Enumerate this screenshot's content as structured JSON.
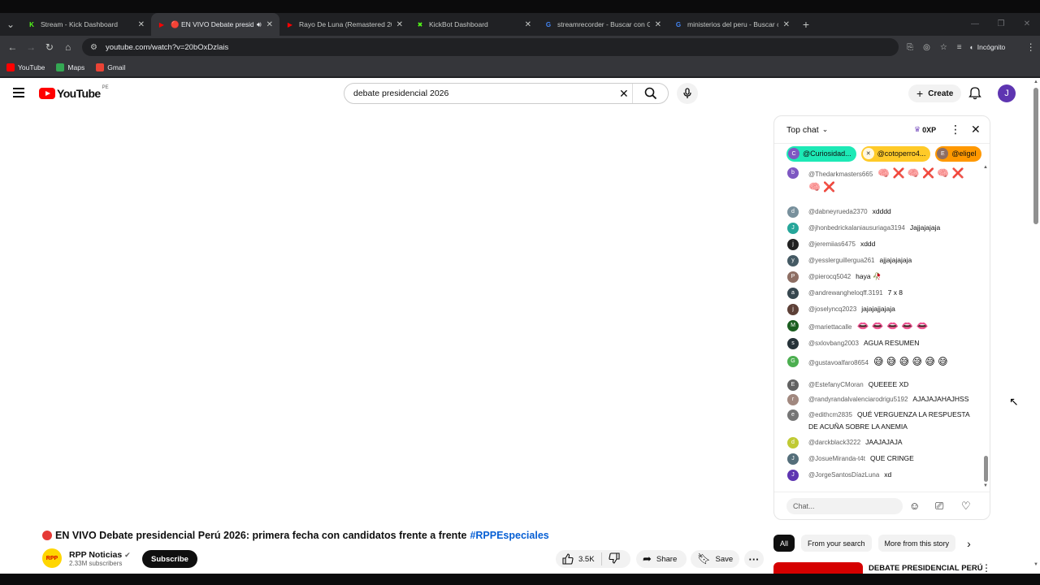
{
  "browser": {
    "tabs": [
      {
        "title": "Stream - Kick Dashboard",
        "color": "#53fc18",
        "glyph": "K"
      },
      {
        "title": "🔴 EN VIVO Debate preside",
        "color": "#ff0000",
        "glyph": "▶",
        "active": true
      },
      {
        "title": "Rayo De Luna (Remastered 201",
        "color": "#ff0000",
        "glyph": "▶"
      },
      {
        "title": "KickBot Dashboard",
        "color": "#53fc18",
        "glyph": "✖"
      },
      {
        "title": "streamrecorder - Buscar con Go",
        "color": "#4285f4",
        "glyph": "G"
      },
      {
        "title": "ministerios del peru - Buscar co",
        "color": "#4285f4",
        "glyph": "G"
      }
    ],
    "url": "youtube.com/watch?v=20bOxDzlais",
    "incognito_label": "Incógnito",
    "bookmarks": [
      {
        "label": "YouTube",
        "color": "#ff0000"
      },
      {
        "label": "Maps",
        "color": "#34a853"
      },
      {
        "label": "Gmail",
        "color": "#ea4335"
      }
    ]
  },
  "youtube": {
    "logo_word": "YouTube",
    "country_code": "PE",
    "search_value": "debate presidencial 2026",
    "create_label": "Create",
    "avatar_letter": "J"
  },
  "video": {
    "title": "EN VIVO Debate presidencial Perú 2026: primera fecha con candidatos frente a frente",
    "hashtag": "#RPPEspeciales",
    "channel_name": "RPP Noticias",
    "channel_logo_text": "RPP",
    "subscribers": "2.33M subscribers",
    "subscribe_label": "Subscribe",
    "likes": "3.5K",
    "share_label": "Share",
    "save_label": "Save"
  },
  "chat": {
    "mode_label": "Top chat",
    "xp_label": "0XP",
    "pinned": [
      {
        "name": "@Curiosidad...",
        "bg": "#1de9b6",
        "av_color": "#7e57c2",
        "av": "C"
      },
      {
        "name": "@cotoperro4...",
        "bg": "#ffca28",
        "av_color": "#fff8e1",
        "av": "✕"
      },
      {
        "name": "@eligel",
        "bg": "#ff9800",
        "av_color": "#8d6e63",
        "av": "E"
      }
    ],
    "messages": [
      {
        "author": "@Thedarkmasters665",
        "text": "🧠 ❌ 🧠 ❌ 🧠 ❌ 🧠 ❌",
        "av_color": "#7e57c2",
        "av": "b"
      },
      {
        "author": "@dabneyrueda2370",
        "text": "xdddd",
        "av_color": "#78909c",
        "av": "d"
      },
      {
        "author": "@jhonbedrickalaniausuriaga3194",
        "text": "Jajjajajaja",
        "av_color": "#26a69a",
        "av": "J"
      },
      {
        "author": "@jeremiias6475",
        "text": "xddd",
        "av_color": "#212121",
        "av": "j"
      },
      {
        "author": "@yesslerguillergua261",
        "text": "ajjajajajaja",
        "av_color": "#455a64",
        "av": "y"
      },
      {
        "author": "@pierocq5042",
        "text": "haya 🥀",
        "av_color": "#8d6e63",
        "av": "P"
      },
      {
        "author": "@andrewangheloqff.3191",
        "text": "7 x 8",
        "av_color": "#37474f",
        "av": "a"
      },
      {
        "author": "@joselyncq2023",
        "text": "jajajajjajaja",
        "av_color": "#5d4037",
        "av": "j"
      },
      {
        "author": "@mariettacalle",
        "text": "👄 👄 👄 👄 👄",
        "av_color": "#1b5e20",
        "av": "M"
      },
      {
        "author": "@sxlovbang2003",
        "text": "AGUA RESUMEN",
        "av_color": "#263238",
        "av": "s"
      },
      {
        "author": "@gustavoalfaro8654",
        "text": "😅 😅 😅 😅 😅 😅",
        "av_color": "#4caf50",
        "av": "G"
      },
      {
        "author": "@EstefanyCMoran",
        "text": "QUEEEE XD",
        "av_color": "#616161",
        "av": "E"
      },
      {
        "author": "@randyrandalvalenciarodrigu5192",
        "text": "AJAJAJAHAJHSS",
        "av_color": "#a1887f",
        "av": "r"
      },
      {
        "author": "@edithcm2835",
        "text": "QUÉ VERGUENZA LA RESPUESTA DE ACUÑA SOBRE LA ANEMIA",
        "av_color": "#757575",
        "av": "e"
      },
      {
        "author": "@darckblack3222",
        "text": "JAAJAJAJA",
        "av_color": "#c0ca33",
        "av": "d"
      },
      {
        "author": "@JosueMiranda-t4t",
        "text": "QUE CRINGE",
        "av_color": "#546e7a",
        "av": "J"
      },
      {
        "author": "@JorgeSantosDíazLuna",
        "text": "xd",
        "av_color": "#5e35b1",
        "av": "J"
      }
    ],
    "input_placeholder": "Chat..."
  },
  "filters": [
    {
      "label": "All",
      "selected": true
    },
    {
      "label": "From your search"
    },
    {
      "label": "More from this story"
    }
  ],
  "suggested": {
    "title": "DEBATE PRESIDENCIAL PERÚ"
  }
}
